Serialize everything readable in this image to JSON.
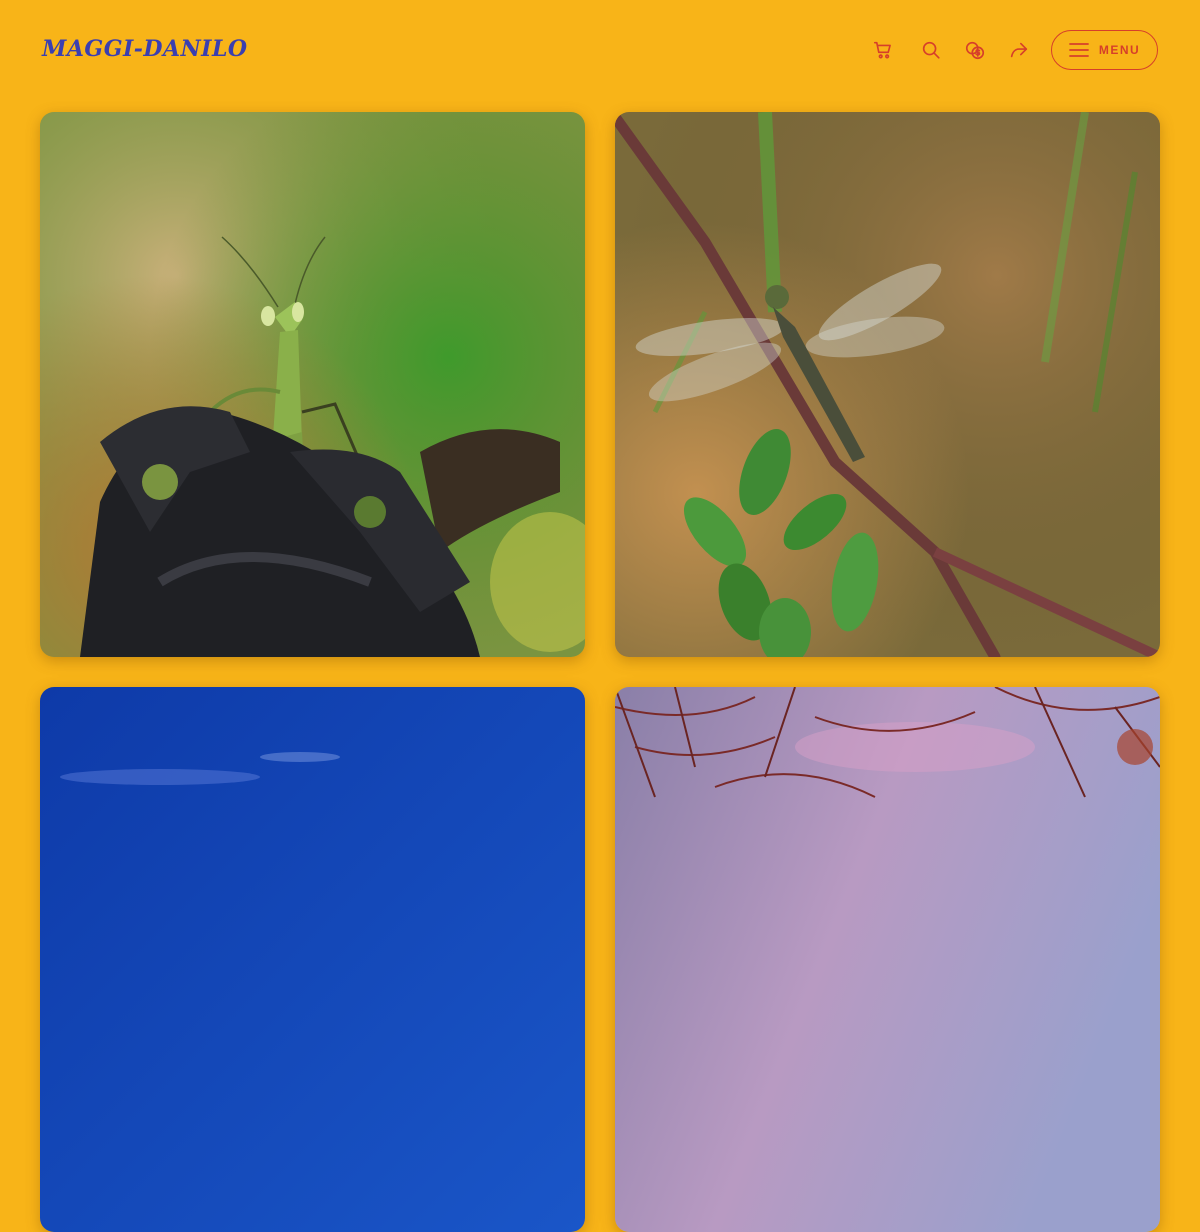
{
  "header": {
    "logo_text": "MAGGI-DANILO",
    "icons": [
      "cart-icon",
      "search-icon",
      "currency-exchange-icon",
      "share-icon"
    ],
    "menu_label": "MENU"
  },
  "gallery": {
    "photos": [
      {
        "subject": "praying-mantis"
      },
      {
        "subject": "dragonfly"
      },
      {
        "subject": "blue-sky"
      },
      {
        "subject": "trees-against-sky"
      }
    ]
  },
  "colors": {
    "background": "#f8b418",
    "logo": "#3b3fb0",
    "accent": "#d63f2a"
  }
}
